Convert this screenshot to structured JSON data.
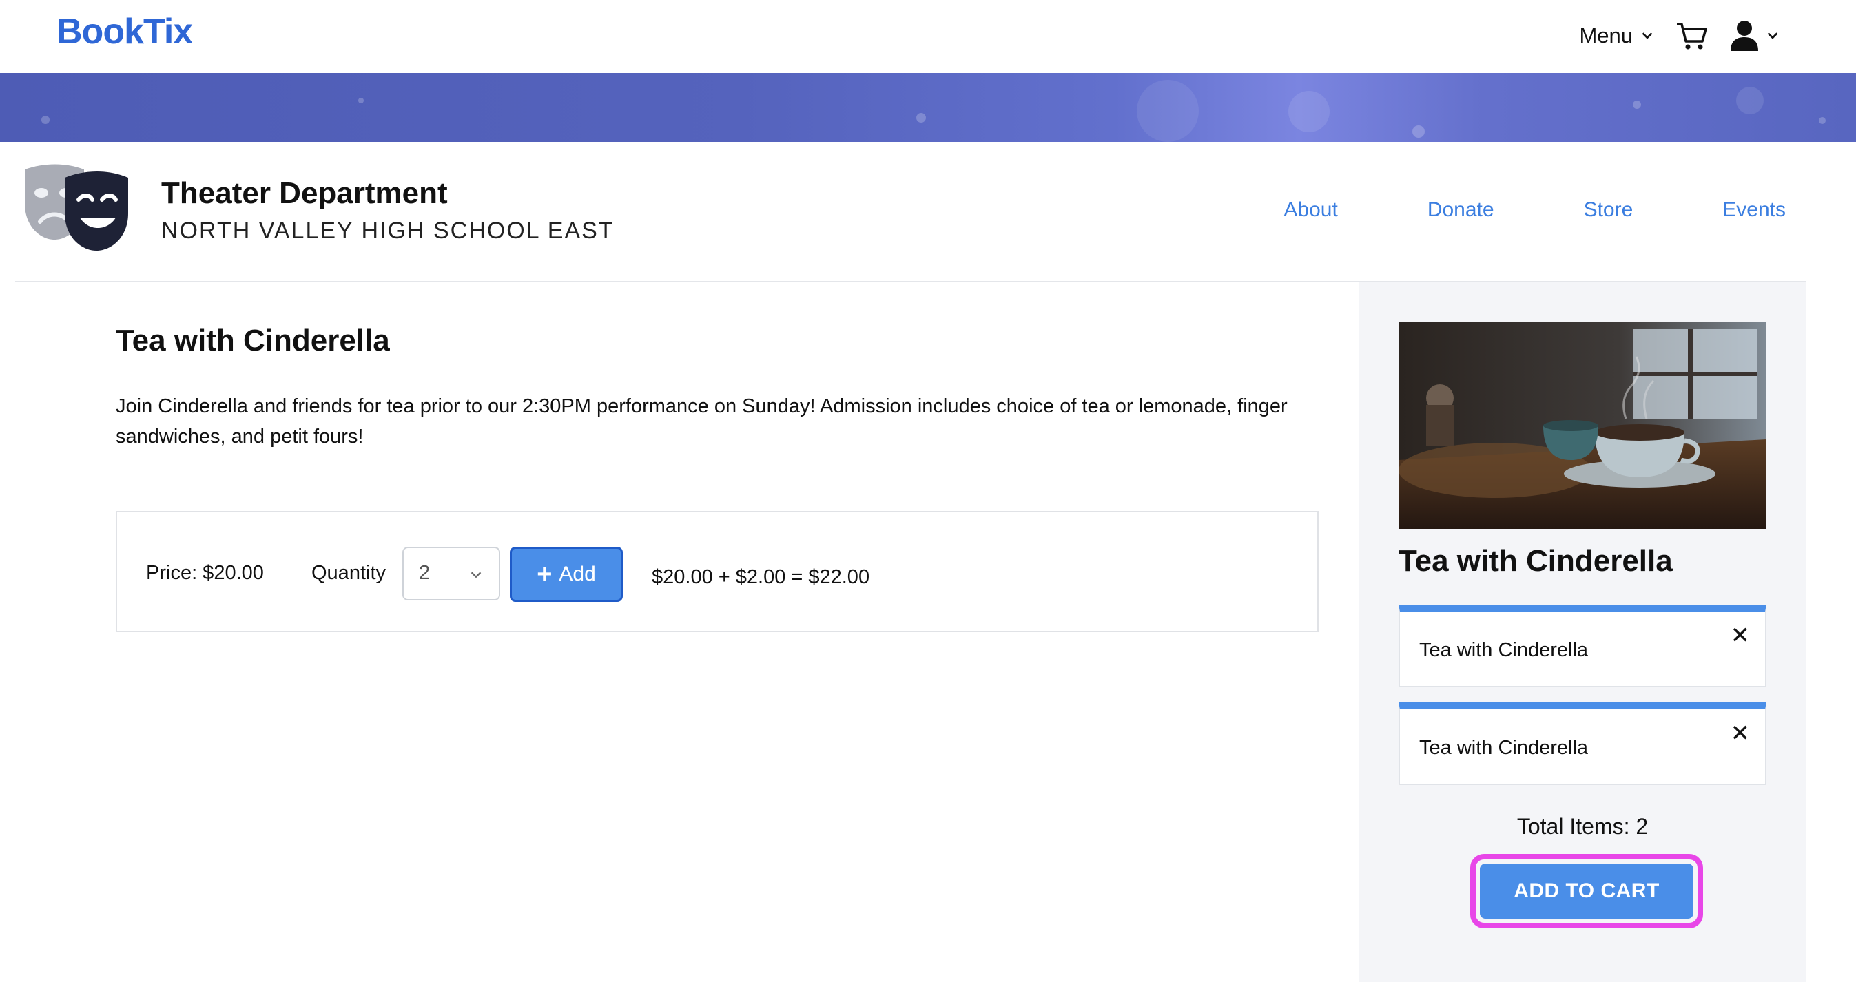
{
  "brand": {
    "name": "BookTix",
    "color": "#2f67d6"
  },
  "topnav": {
    "menu_label": "Menu",
    "cart_icon": "cart-icon",
    "user_icon": "user-icon"
  },
  "org": {
    "name": "Theater Department",
    "school": "NORTH VALLEY HIGH SCHOOL EAST",
    "nav": [
      "About",
      "Donate",
      "Store",
      "Events"
    ]
  },
  "event": {
    "title": "Tea with Cinderella",
    "description": "Join Cinderella and friends for tea prior to our 2:30PM performance on Sunday! Admission includes choice of tea or lemonade, finger sandwiches, and petit fours!",
    "price_label": "Price: $20.00",
    "quantity_label": "Quantity",
    "quantity_value": "2",
    "add_label": "Add",
    "price_calc": "$20.00 + $2.00 = $22.00"
  },
  "sidebar": {
    "title": "Tea with Cinderella",
    "cart_items": [
      {
        "name": "Tea with Cinderella"
      },
      {
        "name": "Tea with Cinderella"
      }
    ],
    "total_items": "Total Items: 2",
    "add_to_cart_label": "ADD TO CART",
    "accent_color": "#4a8ee8",
    "highlight_color": "#e846e8"
  }
}
